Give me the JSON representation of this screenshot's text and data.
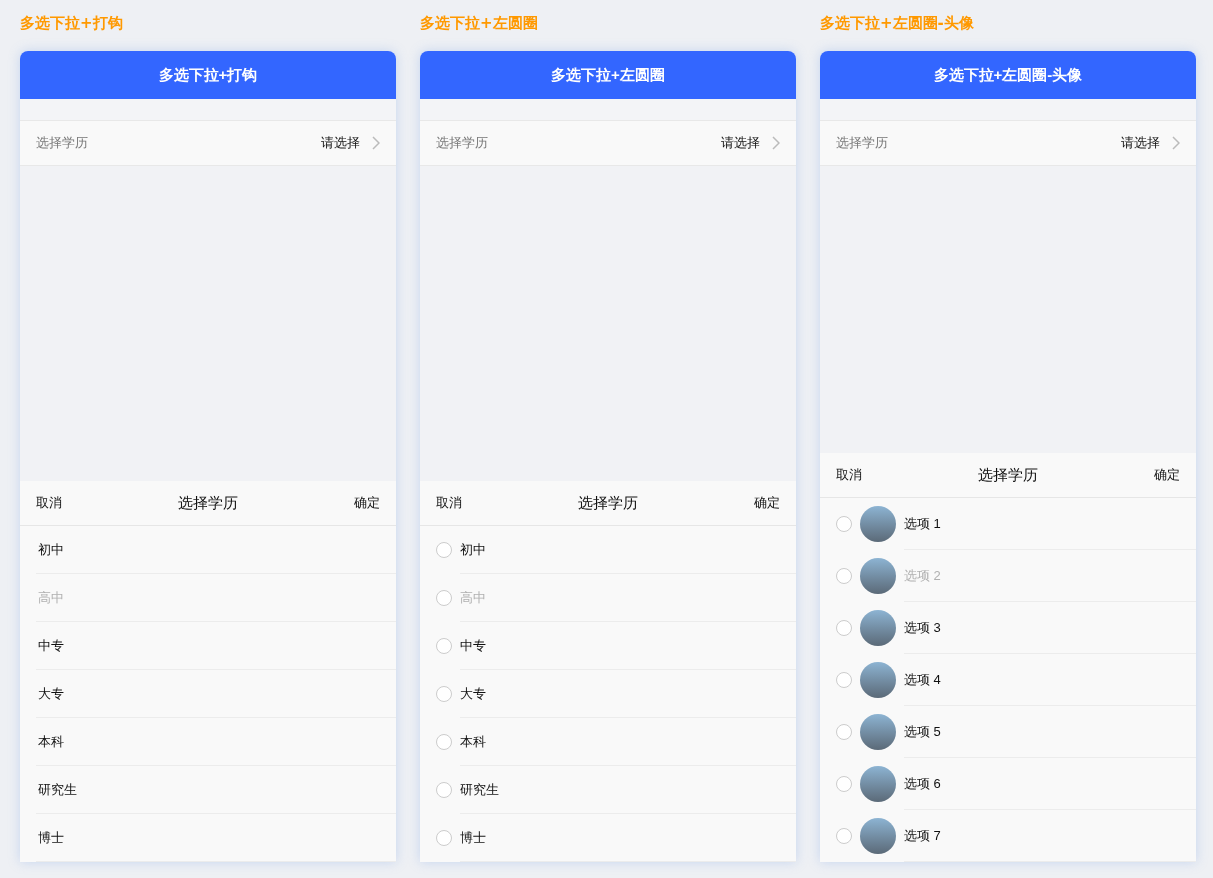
{
  "panels": [
    {
      "kind": "check",
      "section_title": "多选下拉+打钩",
      "header_title": "多选下拉+打钩",
      "field": {
        "label": "选择学历",
        "value": "请选择"
      },
      "popup": {
        "cancel": "取消",
        "title": "选择学历",
        "confirm": "确定"
      },
      "options": [
        {
          "label": "初中",
          "disabled": false,
          "checked": false
        },
        {
          "label": "高中",
          "disabled": true,
          "checked": false
        },
        {
          "label": "中专",
          "disabled": false,
          "checked": false
        },
        {
          "label": "大专",
          "disabled": false,
          "checked": false
        },
        {
          "label": "本科",
          "disabled": false,
          "checked": false
        },
        {
          "label": "研究生",
          "disabled": false,
          "checked": false
        },
        {
          "label": "博士",
          "disabled": false,
          "checked": false
        }
      ]
    },
    {
      "kind": "circle",
      "section_title": "多选下拉+左圆圈",
      "header_title": "多选下拉+左圆圈",
      "field": {
        "label": "选择学历",
        "value": "请选择"
      },
      "popup": {
        "cancel": "取消",
        "title": "选择学历",
        "confirm": "确定"
      },
      "options": [
        {
          "label": "初中",
          "disabled": false,
          "checked": false
        },
        {
          "label": "高中",
          "disabled": true,
          "checked": false
        },
        {
          "label": "中专",
          "disabled": false,
          "checked": false
        },
        {
          "label": "大专",
          "disabled": false,
          "checked": false
        },
        {
          "label": "本科",
          "disabled": false,
          "checked": false
        },
        {
          "label": "研究生",
          "disabled": false,
          "checked": false
        },
        {
          "label": "博士",
          "disabled": false,
          "checked": false
        }
      ]
    },
    {
      "kind": "avatar",
      "section_title": "多选下拉+左圆圈-头像",
      "header_title": "多选下拉+左圆圈-头像",
      "field": {
        "label": "选择学历",
        "value": "请选择"
      },
      "popup": {
        "cancel": "取消",
        "title": "选择学历",
        "confirm": "确定"
      },
      "options": [
        {
          "label": "选项 1",
          "disabled": false,
          "checked": false
        },
        {
          "label": "选项 2",
          "disabled": true,
          "checked": false
        },
        {
          "label": "选项 3",
          "disabled": false,
          "checked": false
        },
        {
          "label": "选项 4",
          "disabled": false,
          "checked": false
        },
        {
          "label": "选项 5",
          "disabled": false,
          "checked": false
        },
        {
          "label": "选项 6",
          "disabled": false,
          "checked": false
        },
        {
          "label": "选项 7",
          "disabled": false,
          "checked": false
        }
      ]
    }
  ]
}
